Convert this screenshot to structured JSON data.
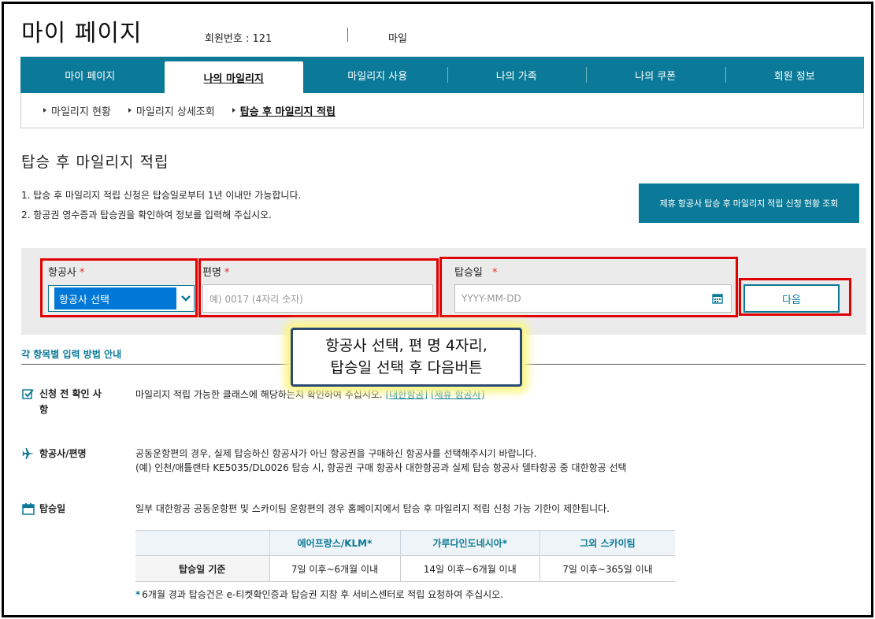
{
  "header": {
    "page_title": "마이 페이지",
    "member_label": "회원번호 : 121",
    "mileage_label": "마일"
  },
  "tabs": [
    {
      "label": "마이 페이지",
      "active": false
    },
    {
      "label": "나의 마일리지",
      "active": true
    },
    {
      "label": "마일리지 사용",
      "active": false
    },
    {
      "label": "나의 가족",
      "active": false
    },
    {
      "label": "나의 쿠폰",
      "active": false
    },
    {
      "label": "회원 정보",
      "active": false
    }
  ],
  "subnav": [
    {
      "label": "마일리지 현황",
      "active": false
    },
    {
      "label": "마일리지 상세조회",
      "active": false
    },
    {
      "label": "탑승 후 마일리지 적립",
      "active": true
    }
  ],
  "section": {
    "title": "탑승 후 마일리지 적립",
    "notes": [
      "1.  탑승 후 마일리지 적립 신청은 탑승일로부터 1년 이내만 가능합니다.",
      "2.  항공권 영수증과 탑승권을 확인하여 정보를 입력해 주십시오."
    ],
    "status_button": "제휴 항공사 탑승 후 마일리지 적립 신청 현황 조회"
  },
  "form": {
    "airline_label": "항공사",
    "airline_value": "항공사 선택",
    "flight_label": "편명",
    "flight_placeholder": "예) 0017 (4자리 숫자)",
    "date_label": "탑승일",
    "date_placeholder": "YYYY-MM-DD",
    "required_mark": "*",
    "next_button": "다음"
  },
  "callout": {
    "line1": "항공사 선택, 편 명 4자리,",
    "line2": "탑승일 선택 후 다음버튼"
  },
  "guide": {
    "title": "각 항목별 입력 방법 안내",
    "rows": [
      {
        "head_line1": "신청 전 확인 사",
        "head_line2": "항",
        "text": "마일리지 적립 가능한 클래스에 해당하는지 확인하여 주십시오.",
        "link1": "[대한항공]",
        "link2": "[제휴 항공사]"
      },
      {
        "head": "항공사/편명",
        "line1": "공동운항편의 경우, 실제 탑승하신 항공사가 아닌 항공권을 구매하신 항공사를 선택해주시기 바랍니다.",
        "line2": "(예) 인천/애틀랜타 KE5035/DL0026 탑승 시, 항공권 구매 항공사 대한항공과 실제 탑승 항공사 델타항공 중 대한항공 선택"
      },
      {
        "head": "탑승일",
        "text": "일부 대한항공 공동운항편 및 스카이팀 운항편의 경우 홈페이지에서 탑승 후 마일리지 적립 신청 가능 기한이 제한됩니다."
      }
    ],
    "table": {
      "headers": [
        "",
        "에어프랑스/KLM*",
        "가루다인도네시아*",
        "그외 스카이팀"
      ],
      "row_label": "탑승일 기준",
      "cells": [
        "7일 이후~6개월 이내",
        "14일 이후~6개월 이내",
        "7일 이후~365일 이내"
      ]
    },
    "footnote_star": "*",
    "footnote": "6개월 경과 탑승건은 e-티켓확인증과 탑승권 지참 후 서비스센터로 적립 요청하여 주십시오."
  },
  "colors": {
    "brand": "#0b7a99",
    "required": "#e0301e",
    "highlight_box": "#e00000",
    "callout_border": "#2b4a73",
    "callout_glow": "#fbf68a"
  }
}
